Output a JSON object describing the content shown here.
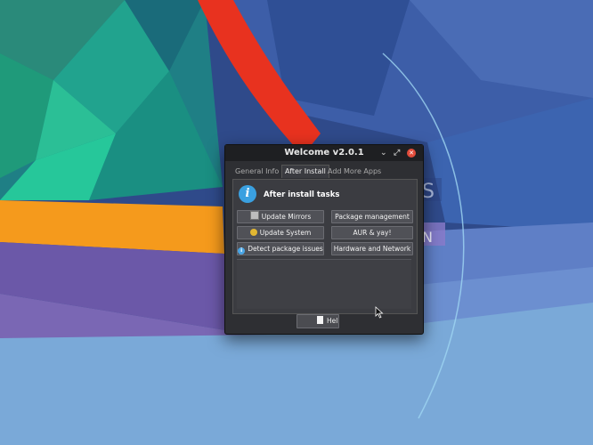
{
  "window": {
    "title": "Welcome v2.0.1",
    "controls": {
      "minimize": "⌄",
      "maximize": "⤢",
      "close": "✕"
    }
  },
  "tabs": [
    {
      "label": "General Info",
      "active": false
    },
    {
      "label": "After Install",
      "active": true
    },
    {
      "label": "Add More Apps",
      "active": false
    }
  ],
  "panel": {
    "header": "After install tasks",
    "buttons_left": [
      {
        "label": "Update Mirrors",
        "icon": "square-icon"
      },
      {
        "label": "Update System",
        "icon": "refresh-icon"
      },
      {
        "label": "Detect package issues",
        "icon": "info-icon"
      }
    ],
    "buttons_right": [
      {
        "label": "Package management"
      },
      {
        "label": "AUR & yay!"
      },
      {
        "label": "Hardware and Network"
      }
    ]
  },
  "footer": {
    "help_label": "Hel"
  },
  "background": {
    "fragment_letter_1": "S",
    "fragment_letter_2": "N"
  },
  "colors": {
    "accent_info": "#3aa0e0",
    "close_button": "#e24c3b",
    "stripe_red": "#e8321f",
    "stripe_orange": "#f59a1c"
  }
}
